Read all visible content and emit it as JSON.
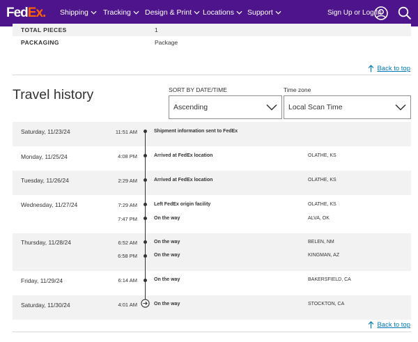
{
  "header": {
    "logo_fed": "Fed",
    "logo_ex": "Ex",
    "logo_dot": ".",
    "nav": [
      "Shipping",
      "Tracking",
      "Design & Print",
      "Locations",
      "Support"
    ],
    "signin": "Sign Up or Log In"
  },
  "package": {
    "rows": [
      {
        "label": "TOTAL PIECES",
        "value": "1"
      },
      {
        "label": "PACKAGING",
        "value": "Package"
      }
    ]
  },
  "back_to_top": "Back to top",
  "travel": {
    "title": "Travel history",
    "sort_label": "SORT BY DATE/TIME",
    "sort_value": "Ascending",
    "tz_label": "Time zone",
    "tz_value": "Local Scan Time",
    "days": [
      {
        "date": "Saturday, 11/23/24",
        "events": [
          {
            "time": "11:51 AM",
            "desc": "Shipment information sent to FedEx",
            "loc": ""
          }
        ]
      },
      {
        "date": "Monday, 11/25/24",
        "events": [
          {
            "time": "4:08 PM",
            "desc": "Arrived at FedEx location",
            "loc": "OLATHE, KS"
          }
        ]
      },
      {
        "date": "Tuesday, 11/26/24",
        "events": [
          {
            "time": "2:29 AM",
            "desc": "Arrived at FedEx location",
            "loc": "OLATHE, KS"
          }
        ]
      },
      {
        "date": "Wednesday, 11/27/24",
        "events": [
          {
            "time": "7:29 AM",
            "desc": "Left FedEx origin facility",
            "loc": "OLATHE, KS"
          },
          {
            "time": "7:47 PM",
            "desc": "On the way",
            "loc": "ALVA, OK"
          }
        ]
      },
      {
        "date": "Thursday, 11/28/24",
        "events": [
          {
            "time": "6:52 AM",
            "desc": "On the way",
            "loc": "BELEN, NM"
          },
          {
            "time": "6:58 PM",
            "desc": "On the way",
            "loc": "KINGMAN, AZ"
          }
        ]
      },
      {
        "date": "Friday, 11/29/24",
        "events": [
          {
            "time": "6:14 AM",
            "desc": "On the way",
            "loc": "BAKERSFIELD, CA"
          }
        ]
      },
      {
        "date": "Saturday, 11/30/24",
        "events": [
          {
            "time": "4:01 AM",
            "desc": "On the way",
            "loc": "STOCKTON, CA"
          }
        ]
      }
    ]
  },
  "colors": {
    "brand_purple": "#4d148c",
    "brand_orange": "#ff6200",
    "link_blue": "#007ab7"
  },
  "icons": {
    "user": "user-circle-icon",
    "search": "search-icon",
    "chevron": "chevron-down-icon",
    "arrow_up": "arrow-up-icon",
    "end": "arrow-right-circle-icon"
  }
}
